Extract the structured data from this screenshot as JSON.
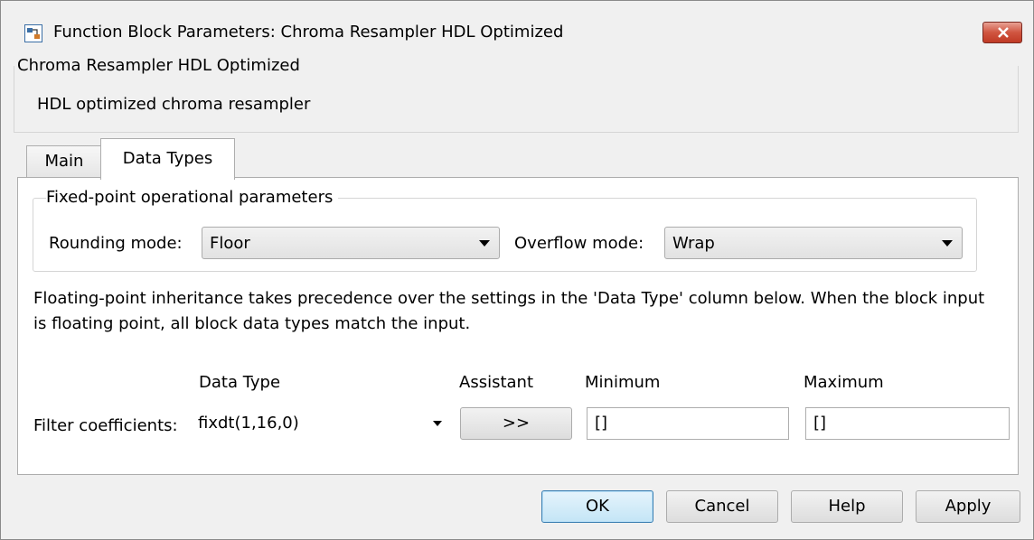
{
  "window": {
    "title": "Function Block Parameters: Chroma Resampler HDL Optimized"
  },
  "block": {
    "name": "Chroma Resampler HDL Optimized",
    "description": "HDL optimized chroma resampler"
  },
  "tabs": [
    {
      "label": "Main",
      "active": false
    },
    {
      "label": "Data Types",
      "active": true
    }
  ],
  "fixed_point": {
    "legend": "Fixed-point operational parameters",
    "rounding_label": "Rounding mode:",
    "rounding_value": "Floor",
    "overflow_label": "Overflow mode:",
    "overflow_value": "Wrap"
  },
  "info_text": "Floating-point inheritance takes precedence over the settings in the 'Data Type' column below. When the block input is floating point, all block data types match the input.",
  "table": {
    "headers": {
      "data_type": "Data Type",
      "assistant": "Assistant",
      "minimum": "Minimum",
      "maximum": "Maximum"
    },
    "row": {
      "label": "Filter coefficients:",
      "data_type": "fixdt(1,16,0)",
      "assistant_button": ">>",
      "minimum": "[]",
      "maximum": "[]"
    }
  },
  "buttons": {
    "ok": "OK",
    "cancel": "Cancel",
    "help": "Help",
    "apply": "Apply"
  },
  "colors": {
    "window_bg": "#f0f0f0",
    "close_button": "#c9432f",
    "default_button": "#c4e5f6"
  }
}
